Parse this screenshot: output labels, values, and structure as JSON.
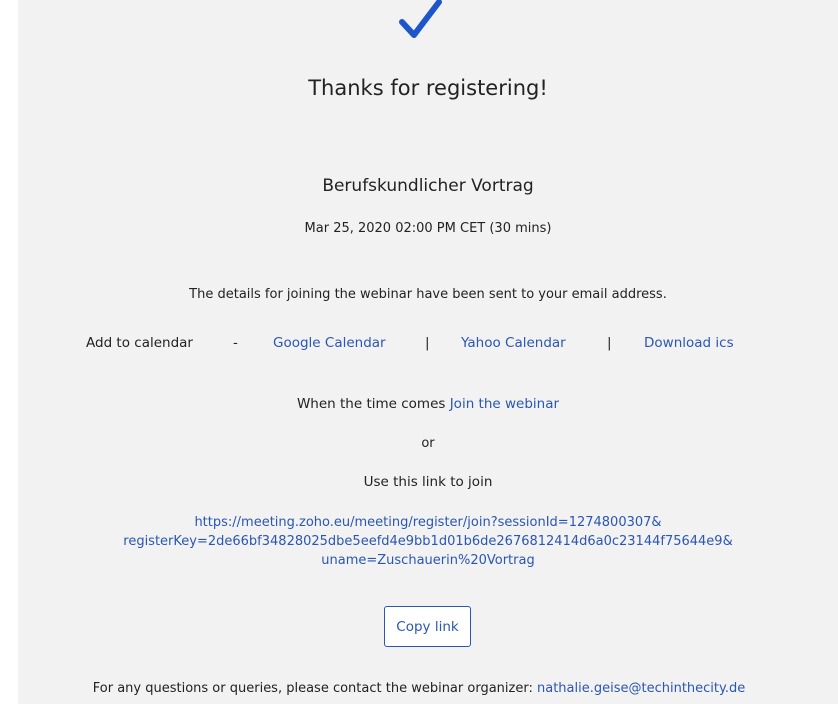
{
  "colors": {
    "accent": "#2a56b5",
    "panel_background": "#f2f2f2",
    "check": "#1d56c9"
  },
  "header": {
    "icon": "checkmark-icon",
    "title": "Thanks for registering!"
  },
  "event": {
    "name": "Berufskundlicher Vortrag",
    "datetime": "Mar 25, 2020 02:00 PM CET (30 mins)"
  },
  "details_text": "The details for joining the webinar have been sent to your email address.",
  "calendar": {
    "label": "Add to calendar",
    "dash": "-",
    "separator": "|",
    "google": "Google Calendar",
    "yahoo": "Yahoo Calendar",
    "ics": "Download ics"
  },
  "join": {
    "prefix": "When the time comes",
    "link": "Join the webinar",
    "or": "or",
    "use_link_text": "Use this link to join",
    "url_lines": [
      "https://meeting.zoho.eu/meeting/register/join?sessionId=1274800307&",
      "registerKey=2de66bf34828025dbe5eefd4e9bb1d01b6de2676812414d6a0c23144f75644e9&",
      "uname=Zuschauerin%20Vortrag"
    ],
    "copy_button": "Copy link"
  },
  "footer": {
    "text": "For any questions or queries, please contact the webinar organizer:",
    "email": "nathalie.geise@techinthecity.de"
  }
}
